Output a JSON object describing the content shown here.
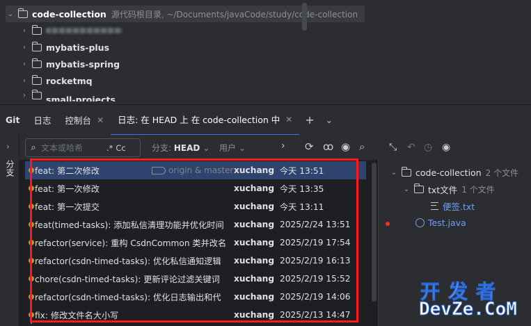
{
  "project_tree": {
    "root_name": "code-collection",
    "root_path": "源代码根目录, ~/Documents/javaCode/study/code-collection",
    "modules": [
      "mybatis-plus",
      "mybatis-spring",
      "rocketmq",
      "small-projects"
    ]
  },
  "tabs": {
    "git": "Git",
    "log": "日志",
    "console": "控制台",
    "active_log": "日志: 在 HEAD 上 在 code-collection 中"
  },
  "left_strip": {
    "label": "分支"
  },
  "toolbar": {
    "search_placeholder": "文本或哈希",
    "regex": ".*",
    "case": "Cc",
    "branch_label": "分支:",
    "branch_value": "HEAD",
    "user_label": "用户"
  },
  "commits": [
    {
      "message": "feat: 第二次修改",
      "refs": "origin & master",
      "author": "xuchang",
      "date": "今天 13:51"
    },
    {
      "message": "feat: 第一次修改",
      "refs": "",
      "author": "xuchang",
      "date": "今天 13:35"
    },
    {
      "message": "feat: 第一次提交",
      "refs": "",
      "author": "xuchang",
      "date": "今天 13:11"
    },
    {
      "message": "feat(timed-tasks): 添加私信清理功能并优化时间",
      "refs": "",
      "author": "xuchang",
      "date": "2025/2/24 13:51"
    },
    {
      "message": "refactor(service): 重构 CsdnCommon 类并改名",
      "refs": "",
      "author": "xuchang",
      "date": "2025/2/19 17:54"
    },
    {
      "message": "refactor(csdn-timed-tasks): 优化私信通知逻辑",
      "refs": "",
      "author": "xuchang",
      "date": "2025/2/19 16:13"
    },
    {
      "message": "chore(csdn-timed-tasks): 更新评论过滤关键词",
      "refs": "",
      "author": "xuchang",
      "date": "2025/2/19 15:52"
    },
    {
      "message": "refactor(csdn-timed-tasks): 优化日志输出和代",
      "refs": "",
      "author": "xuchang",
      "date": "2025/2/19 14:06"
    },
    {
      "message": "fix: 修改文件名大小写",
      "refs": "",
      "author": "xuchang",
      "date": "2025/2/13 14:47"
    }
  ],
  "changes": {
    "root": "code-collection",
    "root_count": "2 个文件",
    "folder": "txt文件",
    "folder_count": "1 个文件",
    "file1": "便签.txt",
    "file2": "Test.java"
  },
  "watermark": {
    "line1": "开发者",
    "line2": "DevZe.CoM"
  },
  "colors": {
    "accent": "#3574f0",
    "selection": "#2e436e",
    "annotation": "#ff1a1a",
    "graph": "#c78f4a"
  }
}
